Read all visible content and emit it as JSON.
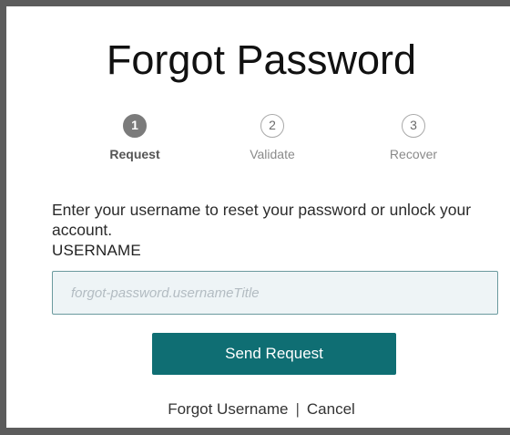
{
  "page": {
    "title": "Forgot Password"
  },
  "steps": [
    {
      "number": "1",
      "label": "Request",
      "state": "active"
    },
    {
      "number": "2",
      "label": "Validate",
      "state": "inactive"
    },
    {
      "number": "3",
      "label": "Recover",
      "state": "inactive"
    }
  ],
  "form": {
    "instructions": "Enter your username to reset your password or unlock your account.",
    "username_label": "USERNAME",
    "username_value": "",
    "username_placeholder": "forgot-password.usernameTitle",
    "submit_label": "Send Request"
  },
  "links": {
    "forgot_username": "Forgot Username",
    "separator": "|",
    "cancel": "Cancel"
  },
  "colors": {
    "accent": "#0f6e73",
    "input_background": "#eef4f6",
    "active_step": "#7b7b7b"
  }
}
